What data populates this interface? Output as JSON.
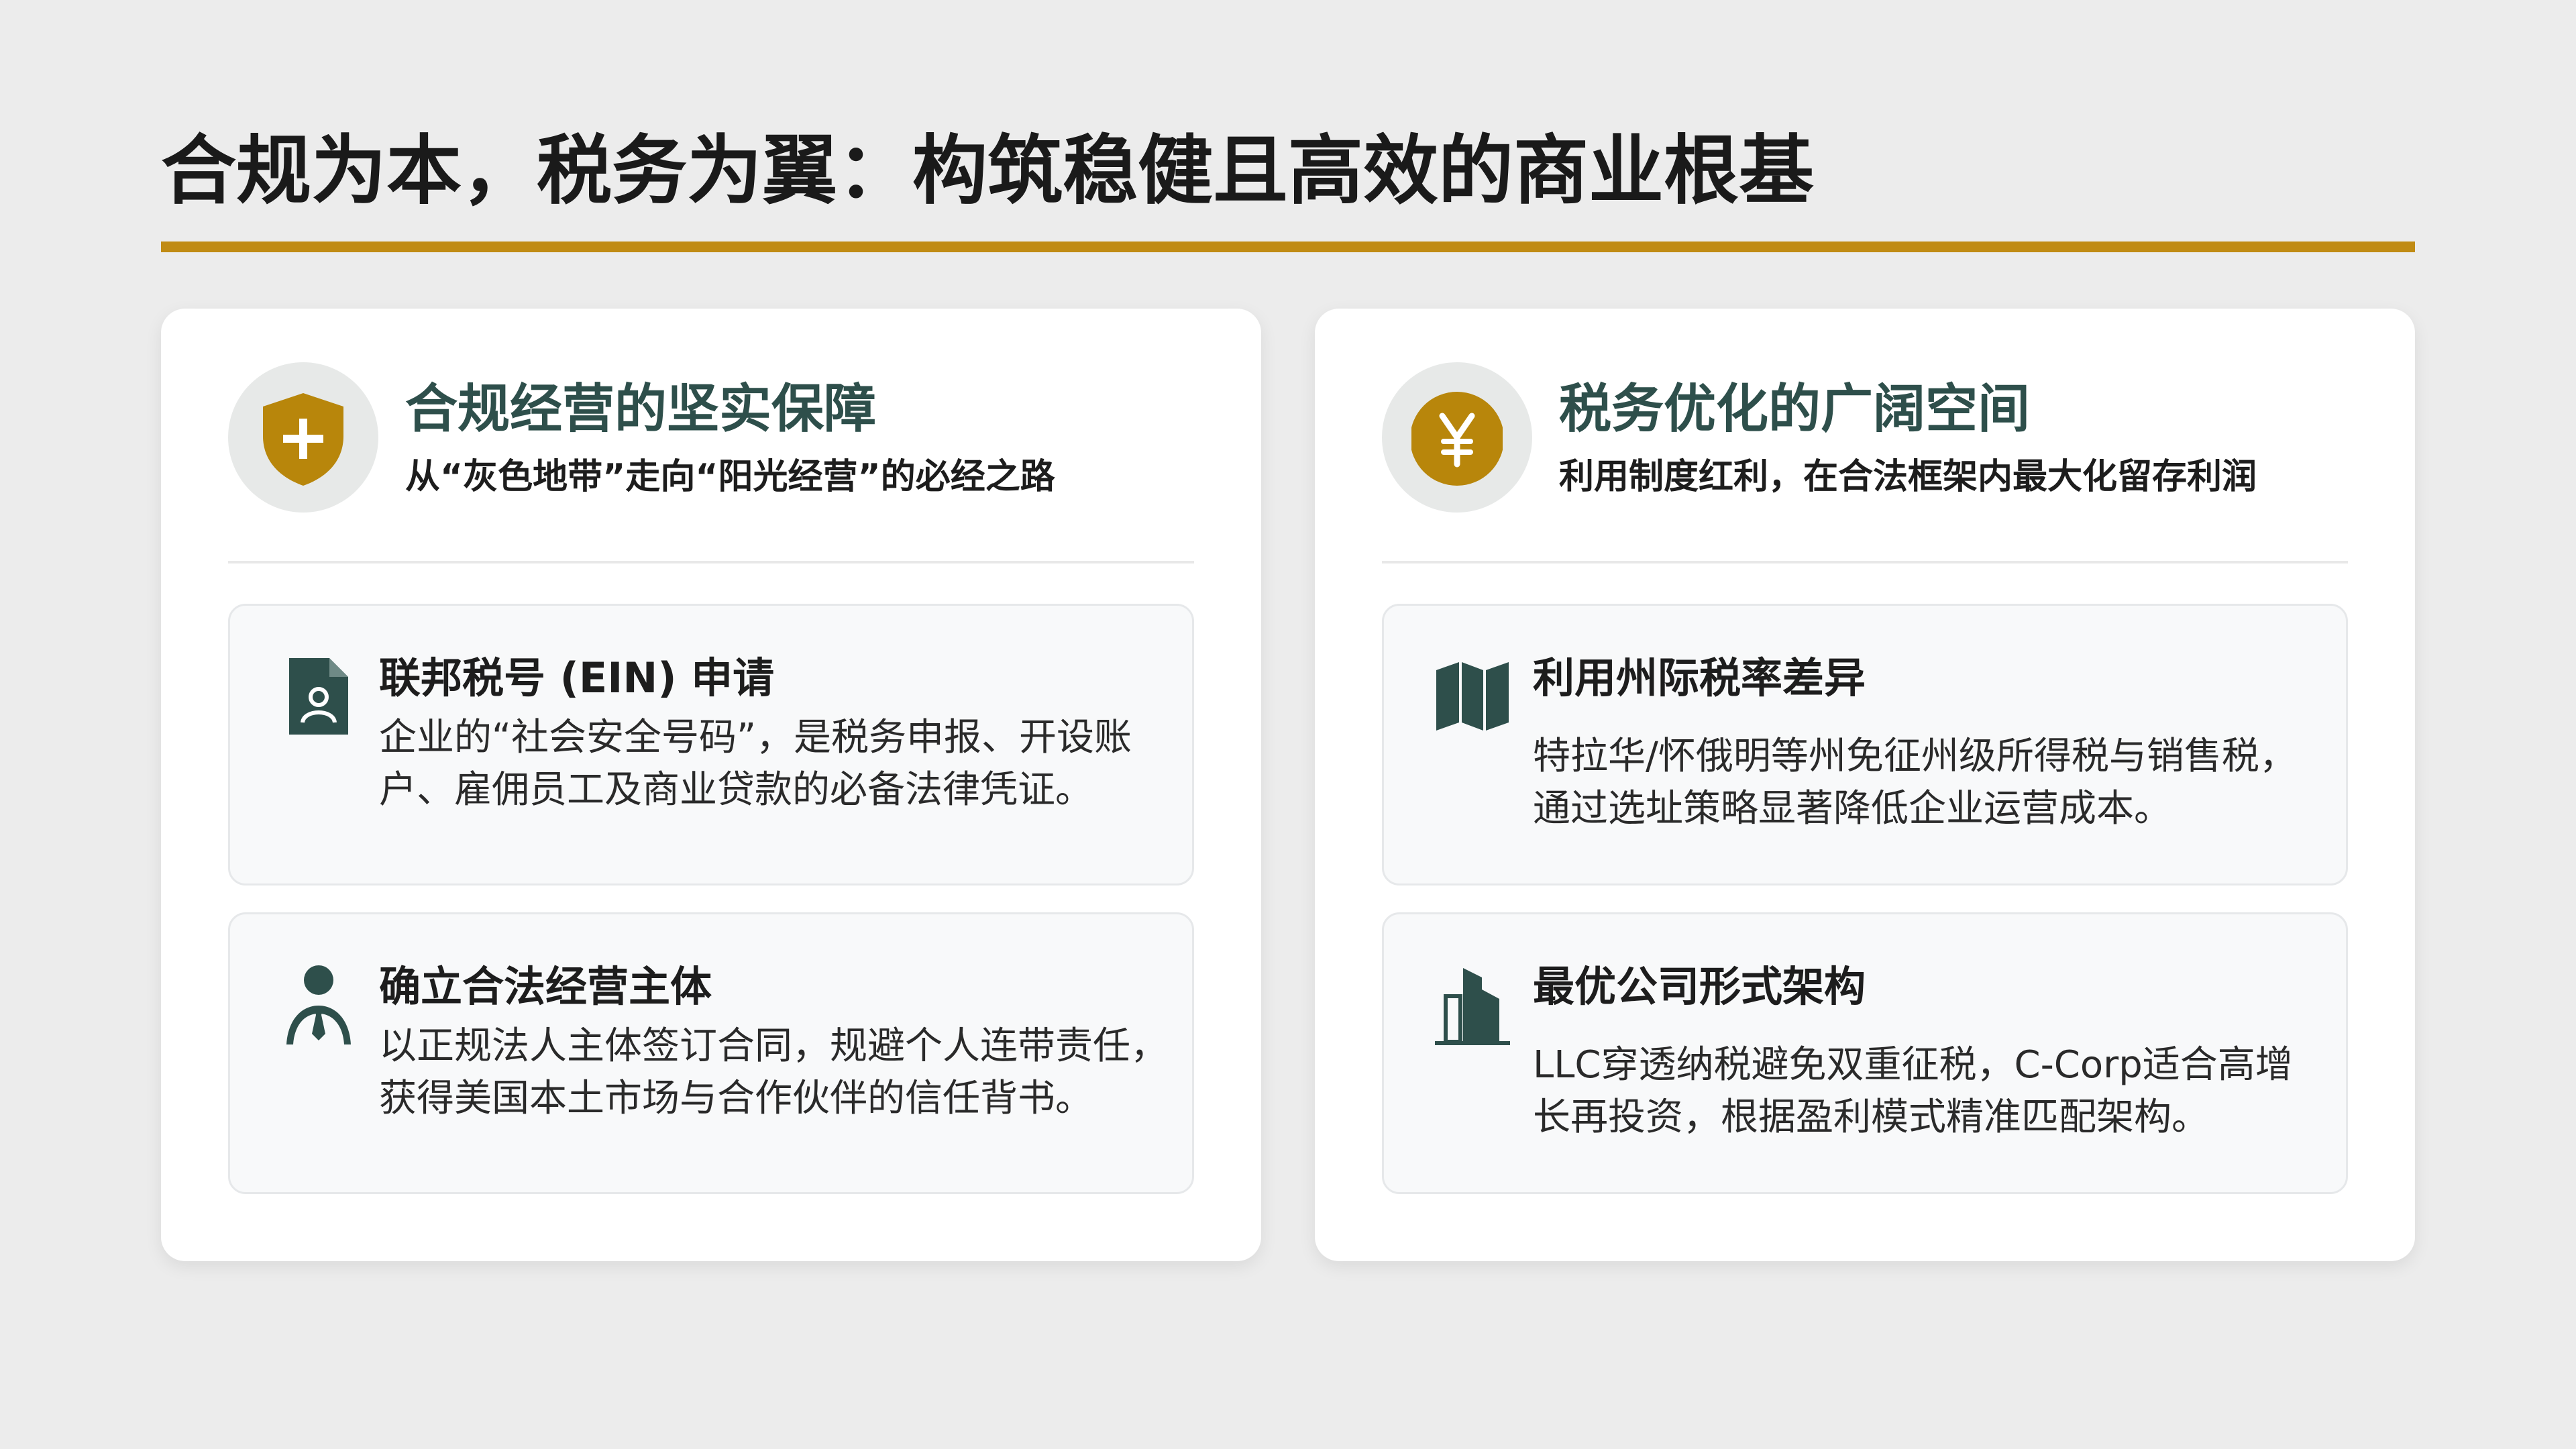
{
  "page": {
    "title": "合规为本，税务为翼：构筑稳健且高效的商业根基"
  },
  "colors": {
    "accent_gold": "#c08b14",
    "heading_teal": "#2e4f4b",
    "icon_dark": "#2e4f4b",
    "background": "#ececec"
  },
  "left_card": {
    "icon": "shield-plus-icon",
    "title": "合规经营的坚实保障",
    "subtitle": "从“灰色地带”走向“阳光经营”的必经之路",
    "items": [
      {
        "icon": "id-document-icon",
        "title": "联邦税号 (EIN) 申请",
        "description": "企业的“社会安全号码”，是税务申报、开设账户、雇佣员工及商业贷款的必备法律凭证。"
      },
      {
        "icon": "business-person-icon",
        "title": "确立合法经营主体",
        "description": "以正规法人主体签订合同，规避个人连带责任，获得美国本土市场与合作伙伴的信任背书。"
      }
    ]
  },
  "right_card": {
    "icon": "yen-coin-icon",
    "title": "税务优化的广阔空间",
    "subtitle": "利用制度红利，在合法框架内最大化留存利润",
    "items": [
      {
        "icon": "folded-map-icon",
        "title": "利用州际税率差异",
        "description": "特拉华/怀俄明等州免征州级所得税与销售税，通过选址策略显著降低企业运营成本。"
      },
      {
        "icon": "city-buildings-icon",
        "title": "最优公司形式架构",
        "description": "LLC穿透纳税避免双重征税，C-Corp适合高增长再投资，根据盈利模式精准匹配架构。"
      }
    ]
  }
}
